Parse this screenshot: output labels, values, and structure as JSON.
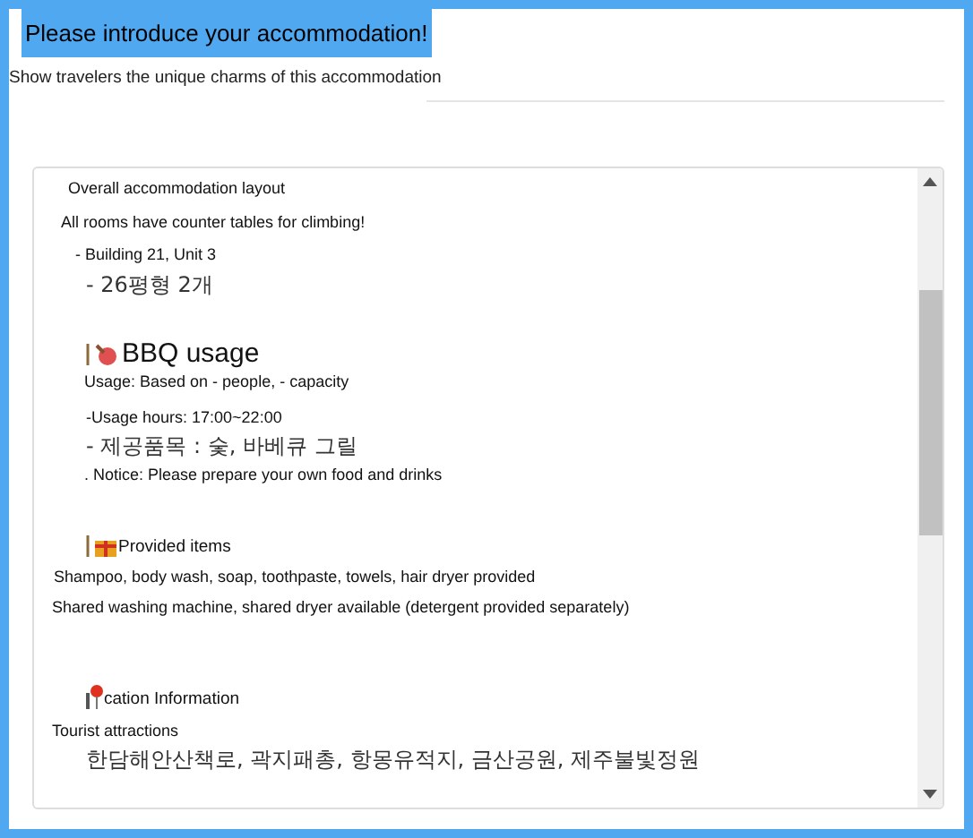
{
  "title": "Please introduce your accommodation!",
  "subtitle": "Show travelers the unique charms of this accommodation",
  "editor": {
    "lines": [
      {
        "kind": "text",
        "text": "Overall accommodation layout"
      },
      {
        "kind": "text",
        "text": "All rooms have counter tables for climbing!"
      },
      {
        "kind": "text",
        "text": "- Building 21, Unit 3"
      },
      {
        "kind": "korean",
        "text": "- 26평형 2개"
      },
      {
        "kind": "heading_large",
        "text": "BBQ usage"
      },
      {
        "kind": "text",
        "text": "Usage: Based on - people, - capacity"
      },
      {
        "kind": "text",
        "text": "-Usage hours: 17:00~22:00"
      },
      {
        "kind": "korean",
        "text": "- 제공품목 : 숯, 바베큐 그릴"
      },
      {
        "kind": "text",
        "text": ".  Notice: Please prepare your own food and drinks"
      },
      {
        "kind": "heading",
        "text": "Provided items"
      },
      {
        "kind": "text",
        "text": "Shampoo, body wash, soap, toothpaste, towels, hair dryer provided"
      },
      {
        "kind": "text",
        "text": "Shared washing machine, shared dryer available (detergent provided separately)"
      },
      {
        "kind": "heading",
        "text": "cation Information"
      },
      {
        "kind": "text",
        "text": "Tourist attractions"
      },
      {
        "kind": "korean",
        "text": "한담해안산책로, 곽지패총, 항몽유적지, 금산공원, 제주불빛정원"
      }
    ]
  }
}
